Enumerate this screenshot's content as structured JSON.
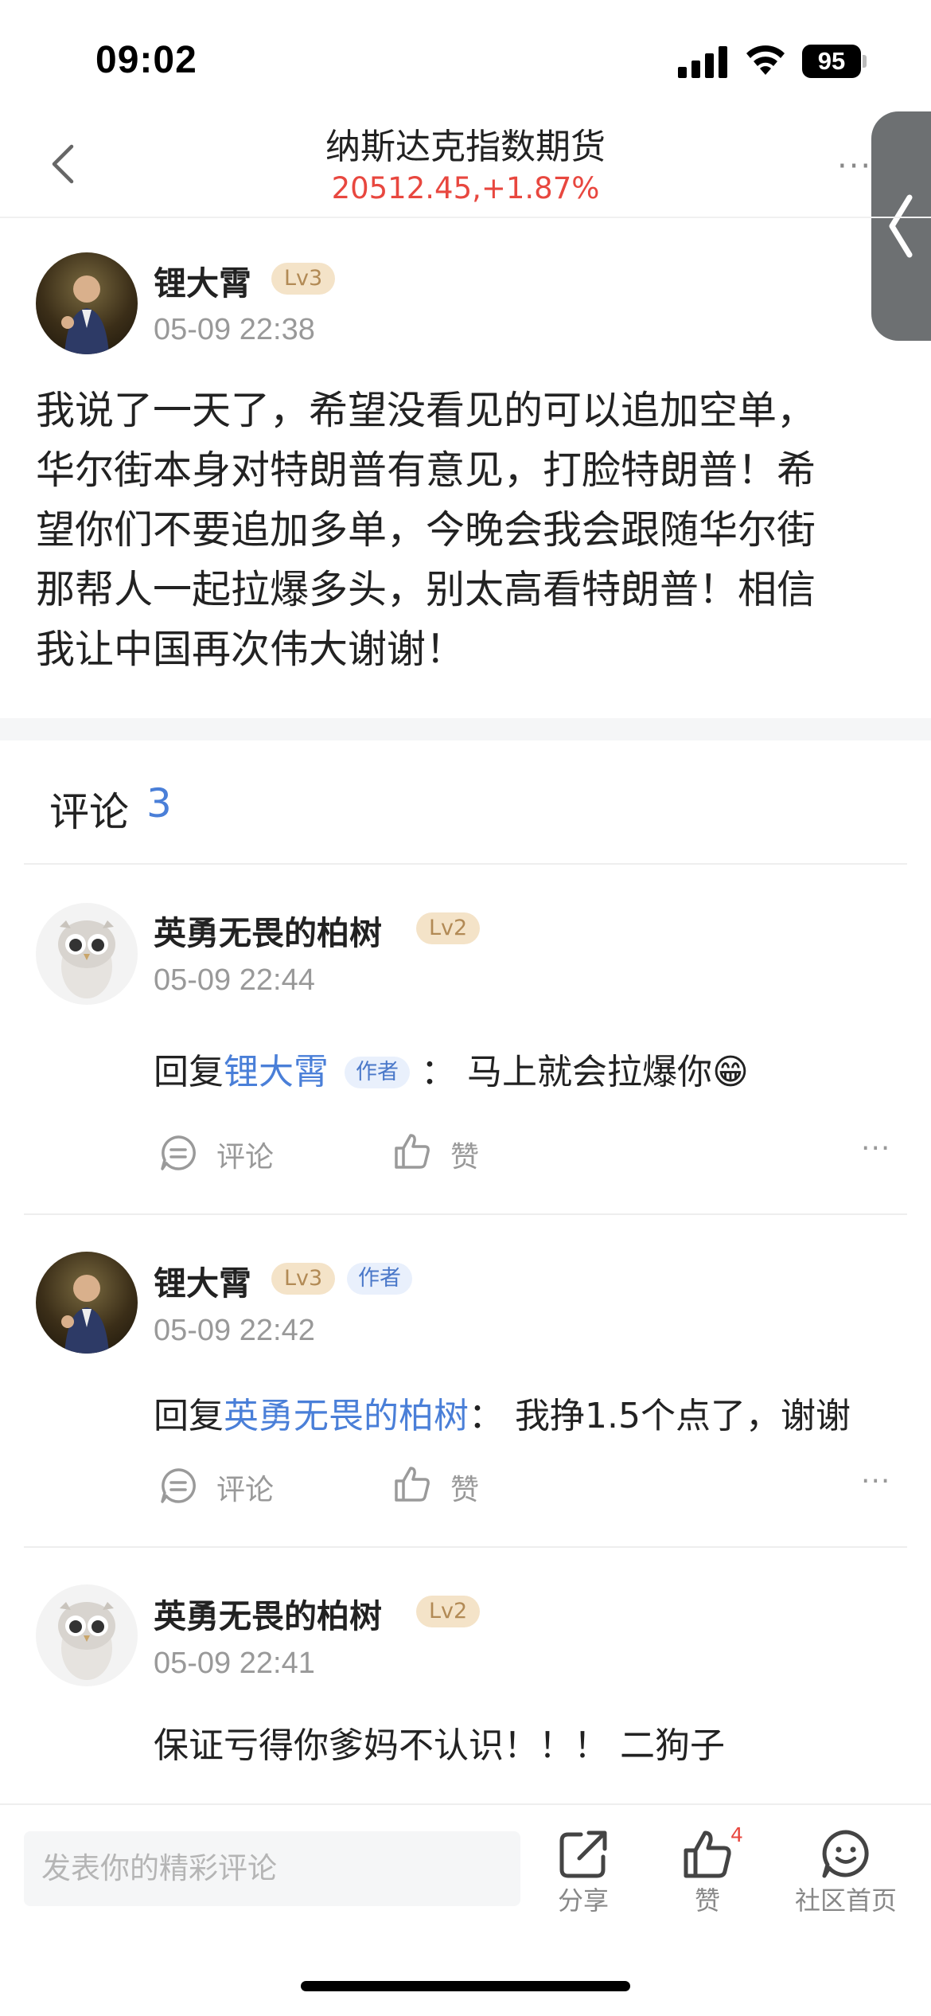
{
  "status_bar": {
    "time": "09:02",
    "battery": "95"
  },
  "header": {
    "title": "纳斯达克指数期货",
    "price": "20512.45,+1.87%"
  },
  "post": {
    "author": "锂大霄",
    "level": "Lv3",
    "time": "05-09 22:38",
    "lines": [
      "我说了一天了，希望没看见的可以追加空单，",
      "华尔街本身对特朗普有意见，打脸特朗普！希",
      "望你们不要追加多单，今晚会我会跟随华尔街",
      "那帮人一起拉爆多头，别太高看特朗普！相信",
      "我让中国再次伟大谢谢！"
    ]
  },
  "comments_section": {
    "label": "评论",
    "count": "3"
  },
  "comments": [
    {
      "author": "英勇无畏的柏树",
      "level": "Lv2",
      "time": "05-09 22:44",
      "reply_prefix": "回复",
      "reply_to": "锂大霄",
      "reply_to_tag": "作者",
      "separator": "：",
      "text": "马上就会拉爆你😁",
      "comment_label": "评论",
      "like_label": "赞"
    },
    {
      "author": "锂大霄",
      "level": "Lv3",
      "author_tag": "作者",
      "time": "05-09 22:42",
      "reply_prefix": "回复",
      "reply_to": "英勇无畏的柏树",
      "separator": "：",
      "text": "我挣1.5个点了，谢谢",
      "comment_label": "评论",
      "like_label": "赞"
    },
    {
      "author": "英勇无畏的柏树",
      "level": "Lv2",
      "time": "05-09 22:41",
      "text": "保证亏得你爹妈不认识！！！ 二狗子"
    }
  ],
  "bottom_bar": {
    "input_placeholder": "发表你的精彩评论",
    "share_label": "分享",
    "like_label": "赞",
    "like_count": "4",
    "community_label": "社区首页"
  },
  "colors": {
    "accent_blue": "#4a7fd8",
    "price_red": "#e8473f",
    "level_gold": "#f4e3c8"
  },
  "icons": [
    "back-icon",
    "more-icon",
    "side-collapse-icon",
    "comment-icon",
    "like-icon",
    "share-icon",
    "community-icon",
    "signal-icon",
    "wifi-icon",
    "battery-icon"
  ]
}
